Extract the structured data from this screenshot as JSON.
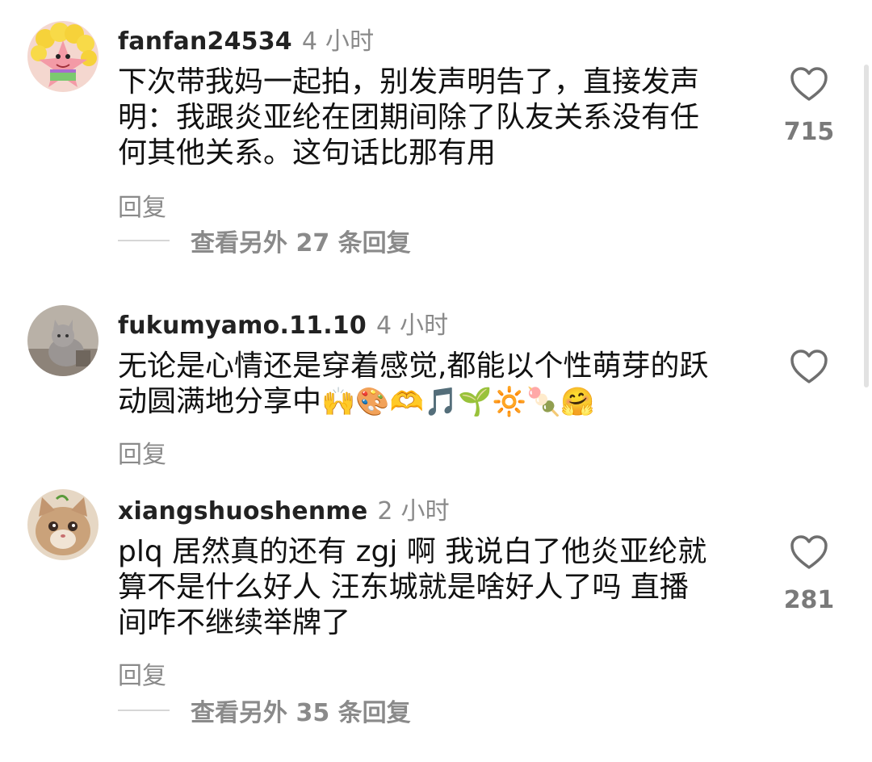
{
  "comments": [
    {
      "username": "fanfan24534",
      "time": "4 小时",
      "lines": [
        "下次带我妈一起拍，别发声明告了，直接发声",
        "明：我跟炎亚纶在团期间除了队友关系没有任",
        "何其他关系。这句话比那有用"
      ],
      "reply_label": "回复",
      "view_replies": "查看另外 27 条回复",
      "likes": "715",
      "avatar_icon": "patrick-star-avatar"
    },
    {
      "username": "fukumyamo.11.10",
      "time": "4 小时",
      "lines": [
        "无论是心情还是穿着感觉,都能以个性萌芽的跃",
        "动圆满地分享中"
      ],
      "emoji": "🙌🎨🫶🎵🌱🔆🍡🤗",
      "reply_label": "回复",
      "likes": "",
      "avatar_icon": "cat-photo-avatar"
    },
    {
      "username": "xiangshuoshenme",
      "time": "2 小时",
      "lines": [
        "plq 居然真的还有 zgj 啊 我说白了他炎亚纶就",
        "算不是什么好人 汪东城就是啥好人了吗 直播",
        "间咋不继续举牌了"
      ],
      "reply_label": "回复",
      "view_replies": "查看另外 35 条回复",
      "likes": "281",
      "avatar_icon": "kitten-avatar"
    }
  ],
  "colors": {
    "text": "#111111",
    "meta": "#8a8a8a",
    "divider": "#d6d6d6"
  }
}
